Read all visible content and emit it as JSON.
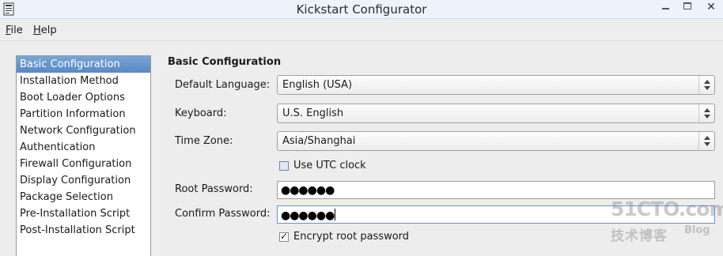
{
  "window": {
    "title": "Kickstart Configurator",
    "close_glyph": "✕"
  },
  "menu": {
    "items": [
      {
        "mnemonic": "F",
        "rest": "ile"
      },
      {
        "mnemonic": "H",
        "rest": "elp"
      }
    ]
  },
  "sidebar": {
    "selected_index": 0,
    "items": [
      {
        "label": "Basic Configuration"
      },
      {
        "label": "Installation Method"
      },
      {
        "label": "Boot Loader Options"
      },
      {
        "label": "Partition Information"
      },
      {
        "label": "Network Configuration"
      },
      {
        "label": "Authentication"
      },
      {
        "label": "Firewall Configuration"
      },
      {
        "label": "Display Configuration"
      },
      {
        "label": "Package Selection"
      },
      {
        "label": "Pre-Installation Script"
      },
      {
        "label": "Post-Installation Script"
      }
    ]
  },
  "form": {
    "section_title": "Basic Configuration",
    "default_language": {
      "label": "Default Language:",
      "value": "English (USA)"
    },
    "keyboard": {
      "label": "Keyboard:",
      "value": "U.S. English"
    },
    "time_zone": {
      "label": "Time Zone:",
      "value": "Asia/Shanghai"
    },
    "use_utc": {
      "label": "Use UTC clock",
      "checked": false
    },
    "root_password": {
      "label": "Root Password:",
      "masked": "●●●●●●"
    },
    "confirm_password": {
      "label": "Confirm Password:",
      "masked": "●●●●●●"
    },
    "encrypt": {
      "label": "Encrypt root password",
      "checked": true,
      "checkmark": "✓"
    }
  },
  "watermark": {
    "line1": "51CTO.com",
    "line2": "技术博客",
    "line3": "Blog"
  },
  "colors": {
    "selection": "#5b88c2",
    "titlebar": "#ecf3fb",
    "background": "#ededed"
  }
}
